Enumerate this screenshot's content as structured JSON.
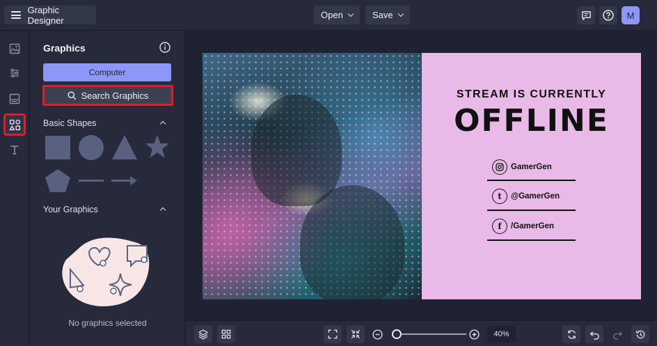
{
  "header": {
    "app_title": "Graphic Designer",
    "open_label": "Open",
    "save_label": "Save",
    "avatar_initial": "M"
  },
  "panel": {
    "title": "Graphics",
    "computer_label": "Computer",
    "search_label": "Search Graphics",
    "basic_shapes_heading": "Basic Shapes",
    "your_graphics_heading": "Your Graphics",
    "empty_text": "No graphics selected"
  },
  "design": {
    "line1": "STREAM IS CURRENTLY",
    "line2": "OFFLINE",
    "socials": [
      {
        "icon": "instagram-icon",
        "handle": "GamerGen"
      },
      {
        "icon": "tumblr-icon",
        "glyph": "t",
        "handle": "@GamerGen"
      },
      {
        "icon": "facebook-icon",
        "glyph": "f",
        "handle": "/GamerGen"
      }
    ],
    "background_color": "#e9b9e7"
  },
  "footer": {
    "zoom_value": "40%"
  },
  "colors": {
    "accent": "#8e97f7",
    "highlight": "#e01e26"
  }
}
